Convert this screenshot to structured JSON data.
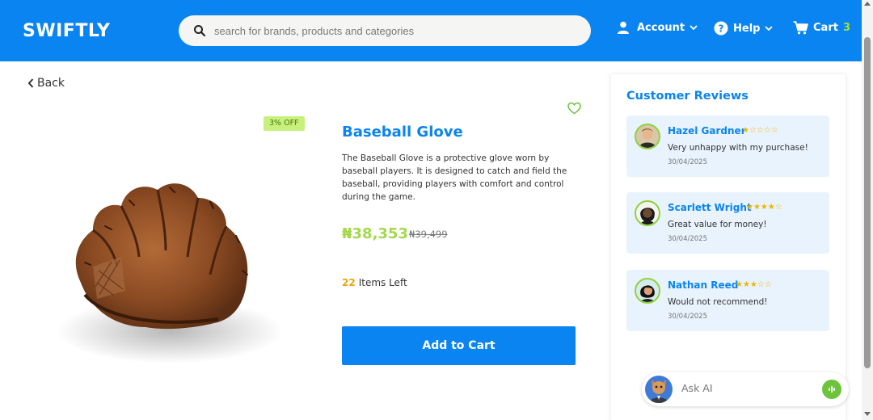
{
  "header": {
    "logo": "SWIFTLY",
    "search_placeholder": "search for brands, products and categories",
    "account_label": "Account",
    "help_label": "Help",
    "cart_label": "Cart",
    "cart_count": "3"
  },
  "nav": {
    "back_label": "Back"
  },
  "product": {
    "discount": "3% OFF",
    "title": "Baseball Glove",
    "description": "The Baseball Glove is a protective glove worn by baseball players. It is designed to catch and field the baseball, providing players with comfort and control during the game.",
    "price": "₦38,353",
    "old_price": "₦39,499",
    "stock_count": "22",
    "stock_label": "Items Left",
    "add_to_cart_label": "Add to Cart"
  },
  "reviews": {
    "title": "Customer Reviews",
    "items": [
      {
        "name": "Hazel Gardner",
        "rating": 1,
        "stars": "★☆☆☆☆",
        "text": "Very unhappy with my purchase!",
        "date": "30/04/2025"
      },
      {
        "name": "Scarlett Wright",
        "rating": 4,
        "stars": "★★★★☆",
        "text": "Great value for money!",
        "date": "30/04/2025"
      },
      {
        "name": "Nathan Reed",
        "rating": 3,
        "stars": "★★★☆☆",
        "text": "Would not recommend!",
        "date": "30/04/2025"
      }
    ]
  },
  "ask_ai": {
    "placeholder": "Ask AI"
  },
  "colors": {
    "brand": "#0a84f0",
    "accent_green": "#a3d94a",
    "stock_orange": "#f0a30a",
    "star": "#f0b400"
  }
}
